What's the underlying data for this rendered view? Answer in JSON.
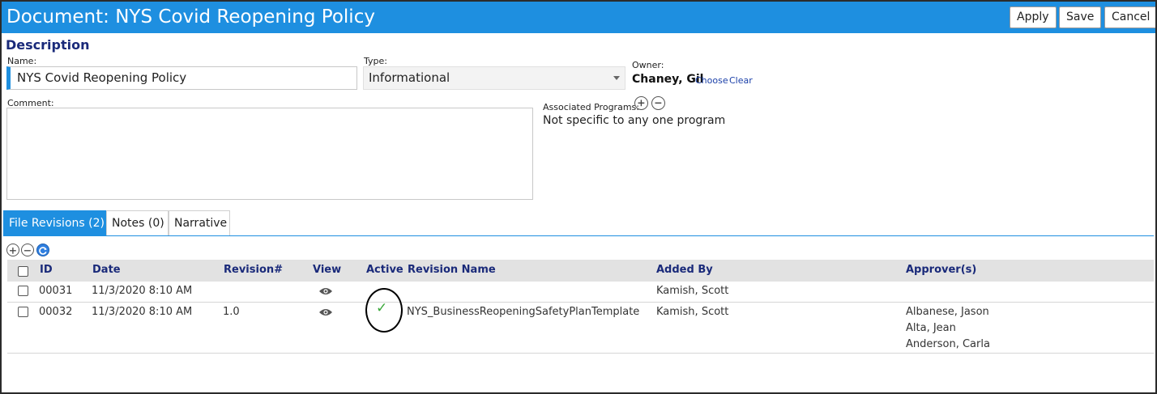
{
  "title": "Document: NYS Covid Reopening Policy",
  "toolbar": {
    "apply_label": "Apply",
    "save_label": "Save",
    "cancel_label": "Cancel"
  },
  "description": {
    "section_title": "Description",
    "name_label": "Name:",
    "name_value": "NYS Covid Reopening Policy",
    "type_label": "Type:",
    "type_value": "Informational",
    "owner_label": "Owner:",
    "owner_name": "Chaney, Gil",
    "owner_choose": "Choose",
    "owner_clear": "Clear",
    "comment_label": "Comment:",
    "comment_value": "",
    "assoc_label": "Associated Programs:",
    "assoc_value": "Not specific to any one program"
  },
  "tabs": [
    {
      "label": "File Revisions (2)",
      "active": true
    },
    {
      "label": "Notes (0)",
      "active": false
    },
    {
      "label": "Narrative",
      "active": false
    }
  ],
  "grid": {
    "headers": {
      "id": "ID",
      "date": "Date",
      "revision": "Revision#",
      "view": "View",
      "active": "Active",
      "revision_name": "Revision Name",
      "added_by": "Added By",
      "approvers": "Approver(s)"
    },
    "rows": [
      {
        "id": "00031",
        "date": "11/3/2020 8:10 AM",
        "revision": "",
        "active": false,
        "revision_name": "",
        "added_by": "Kamish, Scott",
        "approvers": []
      },
      {
        "id": "00032",
        "date": "11/3/2020 8:10 AM",
        "revision": "1.0",
        "active": true,
        "revision_name": "NYS_BusinessReopeningSafetyPlanTemplate",
        "added_by": "Kamish, Scott",
        "approvers": [
          "Albanese, Jason",
          "Alta, Jean",
          "Anderson, Carla"
        ]
      }
    ]
  },
  "icons": {
    "add": "plus-circle-icon",
    "remove": "minus-circle-icon",
    "refresh": "refresh-icon",
    "view": "eye-icon",
    "active": "checkmark-icon"
  },
  "colors": {
    "accent": "#1e8fe0",
    "header_text": "#1a2a7a",
    "active_check": "#3aa83a"
  }
}
